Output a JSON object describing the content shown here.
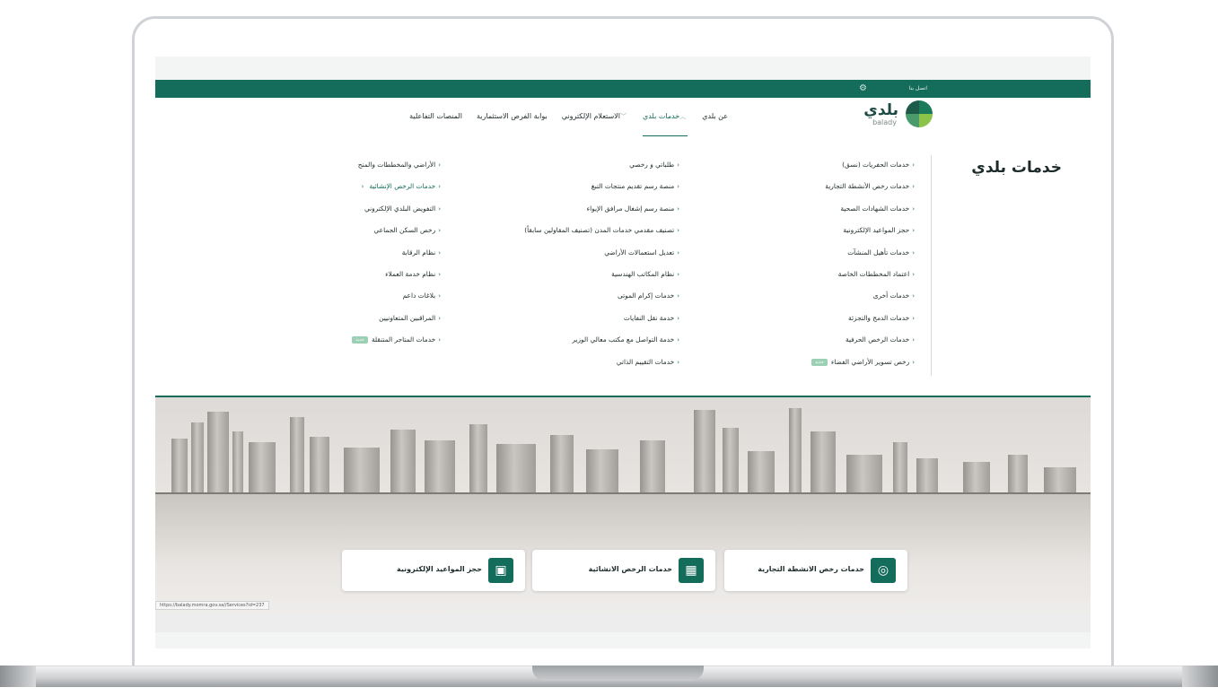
{
  "topbar": {
    "contact": "اتصل بنا"
  },
  "logo": {
    "arabic": "بلدي",
    "english": "balady"
  },
  "nav": [
    {
      "label": "عن بلدي",
      "active": false,
      "dropdown": false
    },
    {
      "label": "خدمات بلدي",
      "active": true,
      "dropdown": true
    },
    {
      "label": "الاستعلام الإلكتروني",
      "active": false,
      "dropdown": true
    },
    {
      "label": "بوابة الفرص الاستثمارية",
      "active": false,
      "dropdown": false
    },
    {
      "label": "المنصات التفاعلية",
      "active": false,
      "dropdown": false
    }
  ],
  "mega": {
    "title": "خدمات بلدي",
    "badge": "جديد",
    "col1": [
      "خدمات الحفريات (نسق)",
      "خدمات رخص الأنشطة التجارية",
      "خدمات الشهادات الصحية",
      "حجز المواعيد الإلكترونية",
      "خدمات تأهيل المنشآت",
      "اعتماد المخططات الخاصة",
      "خدمات أخرى",
      "خدمات الدمج والتجزئة",
      "خدمات الرخص الحرفية",
      "رخص تسوير الأراضي الفضاء"
    ],
    "col2": [
      "طلباتي و رخصي",
      "منصة رسم تقديم منتجات التبغ",
      "منصة رسم إشغال مرافق الإيواء",
      "تصنيف مقدمي خدمات المدن (تصنيف المقاولين سابقاً)",
      "تعديل استعمالات الأراضي",
      "نظام المكاتب الهندسية",
      "خدمات إكرام الموتى",
      "خدمة نقل النفايات",
      "خدمة التواصل مع مكتب معالي الوزير",
      "خدمات التقييم الذاتي"
    ],
    "col3": [
      "الأراضي والمخططات والمنح",
      "خدمات الرخص الإنشائية",
      "التفويض البلدي الإلكتروني",
      "رخص السكن الجماعي",
      "نظام الرقابة",
      "نظام خدمة العملاء",
      "بلاغات داعم",
      "المراقبين المتعاونيين",
      "خدمات المتاجر المتنقلة"
    ]
  },
  "cards": [
    {
      "label": "خدمات رخص الانشطة التجارية",
      "icon": "license-icon"
    },
    {
      "label": "خدمات الرخص الانشائية",
      "icon": "building-icon"
    },
    {
      "label": "حجز المواعيد الإلكترونية",
      "icon": "calendar-icon"
    }
  ],
  "status_url": "https://balady.momra.gov.sa//Services?id=237",
  "colors": {
    "primary": "#146c5b",
    "badge": "#9bd0b4"
  }
}
